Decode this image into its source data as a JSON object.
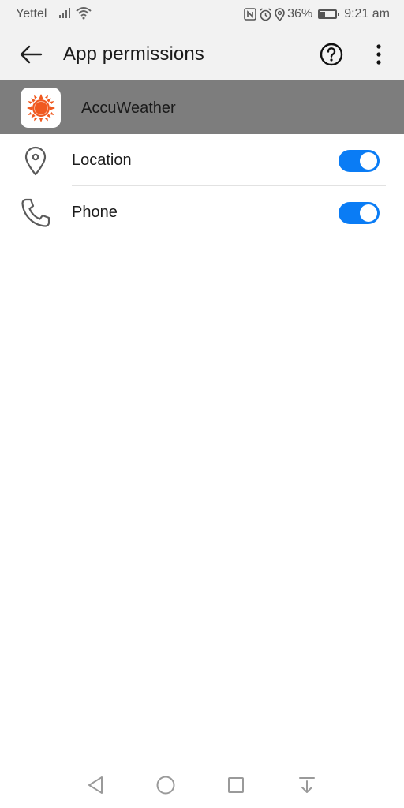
{
  "status_bar": {
    "carrier": "Yettel",
    "battery": "36%",
    "battery_level": 0.36,
    "time": "9:21 am",
    "icons": [
      "signal-icon",
      "wifi-icon",
      "nfc-icon",
      "alarm-icon",
      "location-icon",
      "battery-icon"
    ]
  },
  "toolbar": {
    "title": "App permissions",
    "back_icon": "back-arrow-icon",
    "help_icon": "help-icon",
    "more_icon": "more-vert-icon"
  },
  "app": {
    "name": "AccuWeather",
    "icon": "accuweather-sun-icon",
    "icon_color": "#f0591f"
  },
  "permissions": [
    {
      "label": "Location",
      "icon": "location-pin-icon",
      "enabled": true
    },
    {
      "label": "Phone",
      "icon": "phone-icon",
      "enabled": true
    }
  ],
  "colors": {
    "toggle_on": "#0a7cf5",
    "header_bg": "#7d7d7d",
    "bar_bg": "#f2f2f2"
  },
  "nav_bar": {
    "buttons": [
      "back-triangle-icon",
      "home-circle-icon",
      "recents-square-icon",
      "notification-pull-icon"
    ]
  }
}
